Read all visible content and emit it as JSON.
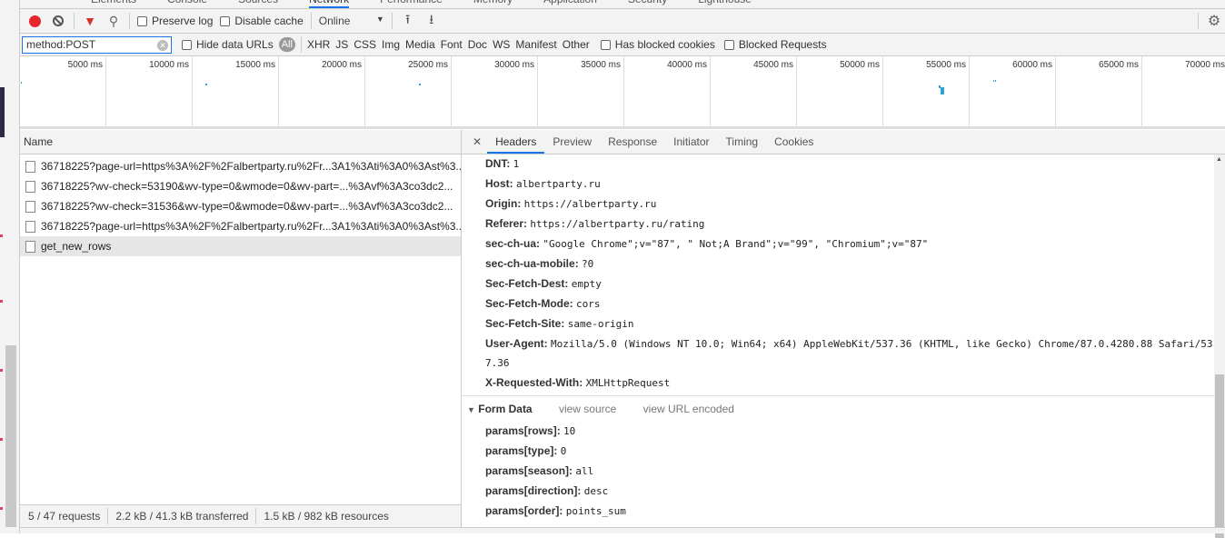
{
  "panel_tabs": [
    "Elements",
    "Console",
    "Sources",
    "Network",
    "Performance",
    "Memory",
    "Application",
    "Security",
    "Lighthouse"
  ],
  "active_panel": "Network",
  "toolbar": {
    "preserve_log": "Preserve log",
    "disable_cache": "Disable cache",
    "throttle": "Online",
    "record_color": "#e8242c",
    "filter_icon_color": "#d93025"
  },
  "filterbar": {
    "filter_value": "method:POST",
    "hide_data_urls": "Hide data URLs",
    "all": "All",
    "types": [
      "XHR",
      "JS",
      "CSS",
      "Img",
      "Media",
      "Font",
      "Doc",
      "WS",
      "Manifest",
      "Other"
    ],
    "has_blocked_cookies": "Has blocked cookies",
    "blocked_requests": "Blocked Requests"
  },
  "timeline": {
    "ticks": [
      "5000 ms",
      "10000 ms",
      "15000 ms",
      "20000 ms",
      "25000 ms",
      "30000 ms",
      "35000 ms",
      "40000 ms",
      "45000 ms",
      "50000 ms",
      "55000 ms",
      "60000 ms",
      "65000 ms",
      "70000 ms"
    ]
  },
  "requests": {
    "column": "Name",
    "rows": [
      "36718225?page-url=https%3A%2F%2Falbertparty.ru%2Fr...3A1%3Ati%3A0%3Ast%3...",
      "36718225?wv-check=53190&wv-type=0&wmode=0&wv-part=...%3Avf%3A3co3dc2...",
      "36718225?wv-check=31536&wv-type=0&wmode=0&wv-part=...%3Avf%3A3co3dc2...",
      "36718225?page-url=https%3A%2F%2Falbertparty.ru%2Fr...3A1%3Ati%3A0%3Ast%3...",
      "get_new_rows"
    ],
    "selected": 4
  },
  "status": {
    "requests": "5 / 47 requests",
    "transferred": "2.2 kB / 41.3 kB transferred",
    "resources": "1.5 kB / 982 kB resources"
  },
  "detail": {
    "tabs": [
      "Headers",
      "Preview",
      "Response",
      "Initiator",
      "Timing",
      "Cookies"
    ],
    "active": "Headers",
    "headers": [
      {
        "k": "DNT:",
        "v": "1"
      },
      {
        "k": "Host:",
        "v": "albertparty.ru"
      },
      {
        "k": "Origin:",
        "v": "https://albertparty.ru"
      },
      {
        "k": "Referer:",
        "v": "https://albertparty.ru/rating"
      },
      {
        "k": "sec-ch-ua:",
        "v": "\"Google Chrome\";v=\"87\", \" Not;A Brand\";v=\"99\", \"Chromium\";v=\"87\""
      },
      {
        "k": "sec-ch-ua-mobile:",
        "v": "?0"
      },
      {
        "k": "Sec-Fetch-Dest:",
        "v": "empty"
      },
      {
        "k": "Sec-Fetch-Mode:",
        "v": "cors"
      },
      {
        "k": "Sec-Fetch-Site:",
        "v": "same-origin"
      },
      {
        "k": "User-Agent:",
        "v": "Mozilla/5.0 (Windows NT 10.0; Win64; x64) AppleWebKit/537.36 (KHTML, like Gecko) Chrome/87.0.4280.88 Safari/53",
        "v2": "7.36"
      },
      {
        "k": "X-Requested-With:",
        "v": "XMLHttpRequest"
      }
    ],
    "form_data": {
      "title": "Form Data",
      "view_source": "view source",
      "view_url_encoded": "view URL encoded",
      "params": [
        {
          "k": "params[rows]:",
          "v": "10"
        },
        {
          "k": "params[type]:",
          "v": "0"
        },
        {
          "k": "params[season]:",
          "v": "all"
        },
        {
          "k": "params[direction]:",
          "v": "desc"
        },
        {
          "k": "params[order]:",
          "v": "points_sum"
        }
      ]
    }
  }
}
